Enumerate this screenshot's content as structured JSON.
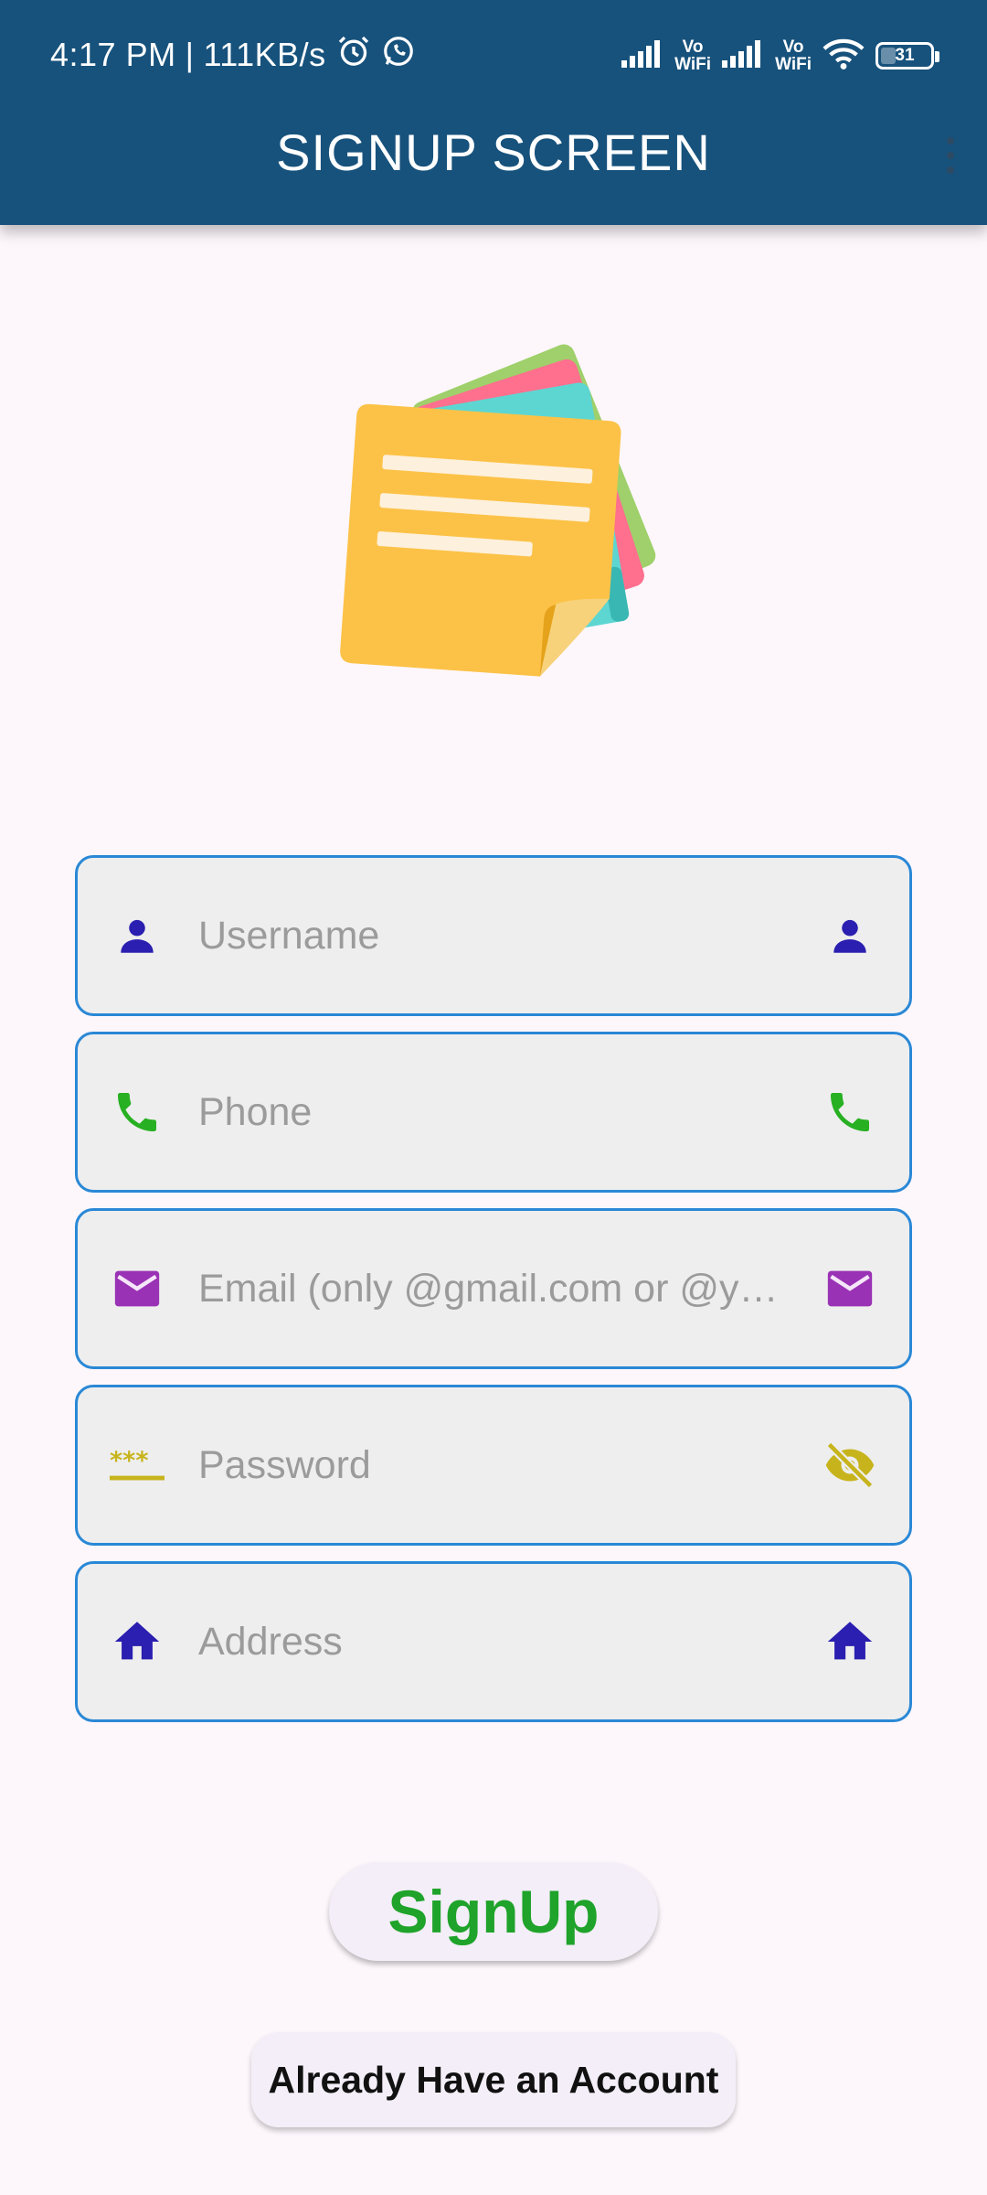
{
  "status_bar": {
    "time": "4:17 PM",
    "separator": "|",
    "net_speed": "111KB/s",
    "vo_label": "Vo",
    "wifi_label": "WiFi",
    "battery": "31"
  },
  "app_bar": {
    "title": "SIGNUP SCREEN"
  },
  "form": {
    "username": {
      "placeholder": "Username",
      "value": ""
    },
    "phone": {
      "placeholder": "Phone",
      "value": ""
    },
    "email": {
      "placeholder": "Email (only @gmail.com or @y…",
      "value": ""
    },
    "password": {
      "placeholder": "Password",
      "value": ""
    },
    "address": {
      "placeholder": "Address",
      "value": ""
    }
  },
  "buttons": {
    "signup": "SignUp",
    "already_have_account": "Already Have an Account"
  },
  "icons": {
    "username": "person-icon",
    "phone": "phone-icon",
    "email": "mail-icon",
    "password": "password-dots-icon",
    "visibility": "visibility-off-icon",
    "address": "home-icon"
  },
  "colors": {
    "app_bar": "#17527c",
    "field_border": "#2a88d6",
    "person_icon": "#2a1fb0",
    "phone_icon": "#27b022",
    "mail_icon": "#9a32b5",
    "password_icon": "#c7b41c",
    "home_icon": "#2a1fb0",
    "signup_text": "#1fa32a"
  }
}
